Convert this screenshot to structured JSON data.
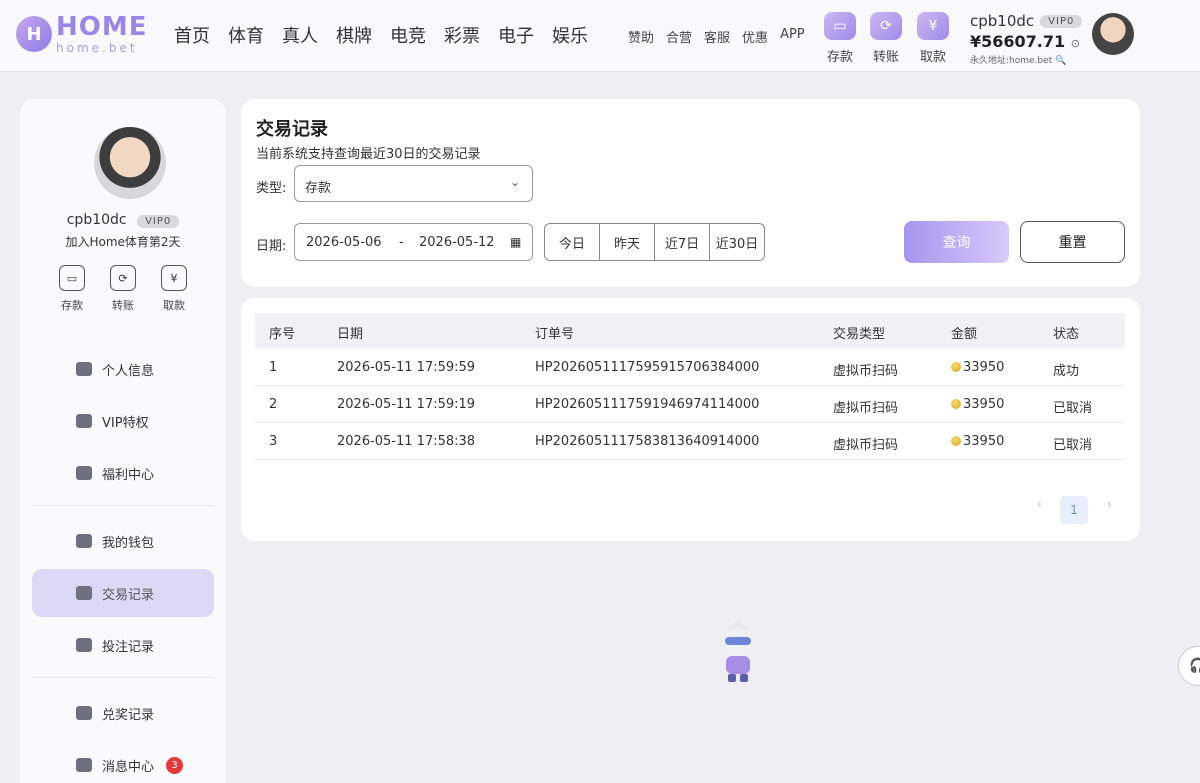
{
  "logo": {
    "name": "HOME",
    "sub": "home.bet",
    "mark": "H"
  },
  "nav": {
    "main": [
      "首页",
      "体育",
      "真人",
      "棋牌",
      "电竞",
      "彩票",
      "电子",
      "娱乐"
    ],
    "sub": [
      "赞助",
      "合营",
      "客服",
      "优惠",
      "APP"
    ]
  },
  "quick_actions": [
    "存款",
    "转账",
    "取款"
  ],
  "account": {
    "username": "cpb10dc",
    "vip": "VIP0",
    "balance": "¥56607.71",
    "permanent_url": "永久地址:home.bet",
    "join_text": "加入Home体育第2天"
  },
  "sidebar": {
    "items": [
      {
        "label": "个人信息",
        "icon": "id-card-icon"
      },
      {
        "label": "VIP特权",
        "icon": "crown-icon"
      },
      {
        "label": "福利中心",
        "icon": "gift-ticket-icon"
      },
      {
        "label": "我的钱包",
        "icon": "wallet-icon"
      },
      {
        "label": "交易记录",
        "icon": "transaction-record-icon"
      },
      {
        "label": "投注记录",
        "icon": "bet-record-icon"
      },
      {
        "label": "兑奖记录",
        "icon": "gift-box-icon"
      },
      {
        "label": "消息中心",
        "icon": "bell-icon",
        "badge": "3"
      }
    ],
    "active": "交易记录"
  },
  "filters": {
    "title": "交易记录",
    "subtitle": "当前系统支持查询最近30日的交易记录",
    "type_label": "类型:",
    "type_value": "存款",
    "date_label": "日期:",
    "date_start": "2026-05-06",
    "date_sep": "-",
    "date_end": "2026-05-12",
    "quick_dates": [
      "今日",
      "昨天",
      "近7日",
      "近30日"
    ],
    "query_button": "查询",
    "reset_button": "重置"
  },
  "table": {
    "headers": [
      "序号",
      "日期",
      "订单号",
      "交易类型",
      "金额",
      "状态"
    ],
    "rows": [
      [
        "1",
        "2026-05-11 17:59:59",
        "HP202605111759591570638400​0",
        "虚拟币扫码",
        "33950",
        "成功"
      ],
      [
        "2",
        "2026-05-11 17:59:19",
        "HP202605111759194697411400​0",
        "虚拟币扫码",
        "33950",
        "已取消"
      ],
      [
        "3",
        "2026-05-11 17:58:38",
        "HP202605111758381364091400​0",
        "虚拟币扫码",
        "33950",
        "已取消"
      ]
    ]
  },
  "pagination": {
    "prev": "‹",
    "current": "1",
    "next": "›"
  },
  "icons": {
    "deposit": "wallet-icon",
    "transfer": "transfer-icon",
    "withdraw": "yen-icon",
    "calendar": "calendar-icon",
    "chevron": "chevron-down-icon",
    "help": "headset-icon"
  },
  "colors": {
    "accent": "#a795ef",
    "active_bg": "#ddd8f6",
    "badge": "#e53939"
  }
}
